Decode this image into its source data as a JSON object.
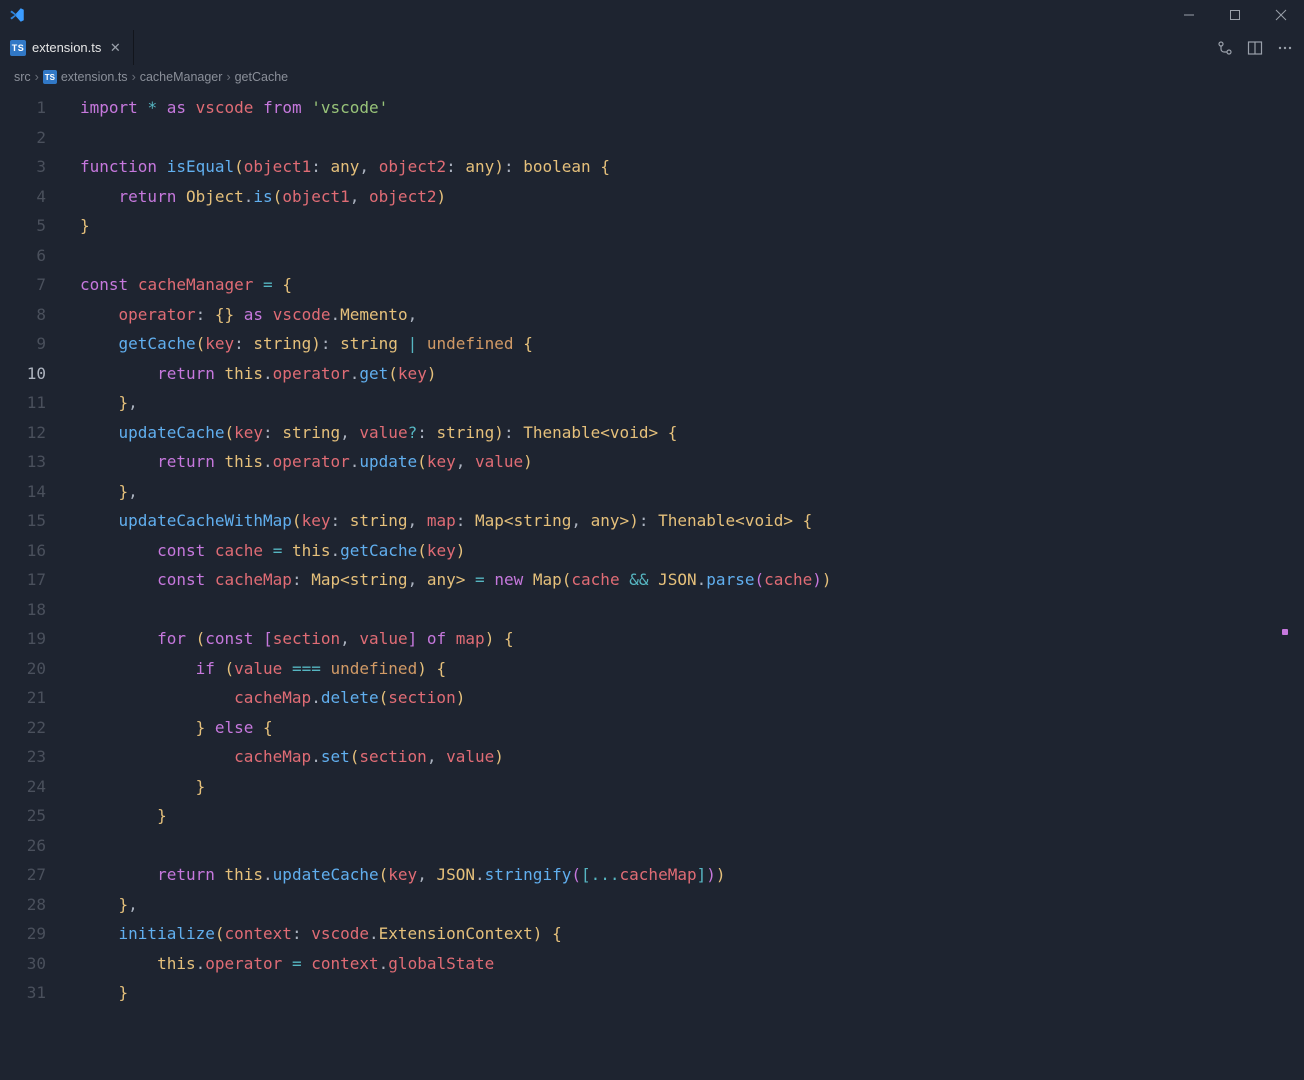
{
  "window": {
    "title": ""
  },
  "tabs": {
    "items": [
      {
        "label": "extension.ts",
        "active": true
      }
    ],
    "actions": {
      "compare": "compare-changes-icon",
      "split": "split-editor-icon",
      "more": "more-icon"
    }
  },
  "breadcrumbs": {
    "segments": [
      {
        "label": "src",
        "icon": null
      },
      {
        "label": "extension.ts",
        "icon": "ts-file-icon"
      },
      {
        "label": "cacheManager",
        "icon": null
      },
      {
        "label": "getCache",
        "icon": null
      }
    ]
  },
  "editor": {
    "language": "typescript",
    "filename": "extension.ts",
    "current_line": 10,
    "first_visible_line": 1,
    "last_visible_line": 31,
    "lines": [
      "import * as vscode from 'vscode'",
      "",
      "function isEqual(object1: any, object2: any): boolean {",
      "    return Object.is(object1, object2)",
      "}",
      "",
      "const cacheManager = {",
      "    operator: {} as vscode.Memento,",
      "    getCache(key: string): string | undefined {",
      "        return this.operator.get(key)",
      "    },",
      "    updateCache(key: string, value?: string): Thenable<void> {",
      "        return this.operator.update(key, value)",
      "    },",
      "    updateCacheWithMap(key: string, map: Map<string, any>): Thenable<void> {",
      "        const cache = this.getCache(key)",
      "        const cacheMap: Map<string, any> = new Map(cache && JSON.parse(cache))",
      "",
      "        for (const [section, value] of map) {",
      "            if (value === undefined) {",
      "                cacheMap.delete(section)",
      "            } else {",
      "                cacheMap.set(section, value)",
      "            }",
      "        }",
      "",
      "        return this.updateCache(key, JSON.stringify([...cacheMap]))",
      "    },",
      "    initialize(context: vscode.ExtensionContext) {",
      "        this.operator = context.globalState",
      "    }"
    ]
  },
  "colors": {
    "background": "#1e2430",
    "accent": "#3178c6"
  }
}
